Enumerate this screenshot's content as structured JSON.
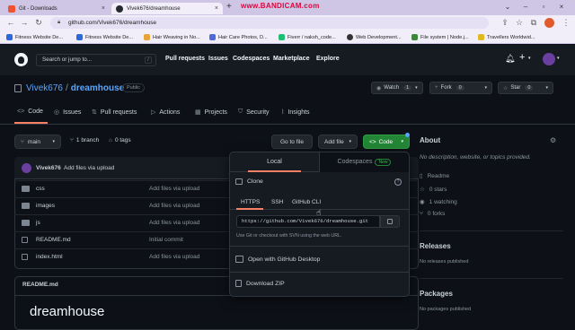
{
  "browser": {
    "tabs": [
      {
        "label": "Git - Downloads",
        "active": false
      },
      {
        "label": "Vivek676/dreamhouse",
        "active": true
      }
    ],
    "recorder_watermark": "www.BANDICAM.com",
    "url": "github.com/Vivek676/dreamhouse",
    "bookmarks": [
      "Fitness Website De...",
      "Fitness Website De...",
      "Hair Weaving in No...",
      "Hair Care Photos, D...",
      "Fiverr / naksh_code...",
      "Web Development...",
      "File system | Node.j...",
      "Travellers Worldwid..."
    ]
  },
  "github_header": {
    "search_placeholder": "Search or jump to...",
    "search_shortcut": "/",
    "nav": [
      "Pull requests",
      "Issues",
      "Codespaces",
      "Marketplace",
      "Explore"
    ],
    "plus_label": "+"
  },
  "repo": {
    "owner": "Vivek676",
    "separator": "/",
    "name": "dreamhouse",
    "visibility": "Public",
    "watch": {
      "label": "Watch",
      "count": "1"
    },
    "fork": {
      "label": "Fork",
      "count": "0"
    },
    "star": {
      "label": "Star",
      "count": "0"
    },
    "tabs": [
      "Code",
      "Issues",
      "Pull requests",
      "Actions",
      "Projects",
      "Security",
      "Insights"
    ]
  },
  "code_bar": {
    "branch": "main",
    "branches": "1 branch",
    "tags": "0 tags",
    "go_to_file": "Go to file",
    "add_file": "Add file",
    "code": "Code"
  },
  "commit": {
    "author": "Vivek676",
    "message": "Add files via upload"
  },
  "files": [
    {
      "name": "css",
      "type": "folder",
      "message": "Add files via upload"
    },
    {
      "name": "images",
      "type": "folder",
      "message": "Add files via upload"
    },
    {
      "name": "js",
      "type": "folder",
      "message": "Add files via upload"
    },
    {
      "name": "README.md",
      "type": "file",
      "message": "Initial commit"
    },
    {
      "name": "index.html",
      "type": "file",
      "message": "Add files via upload"
    }
  ],
  "readme": {
    "filename": "README.md",
    "heading": "dreamhouse"
  },
  "about": {
    "title": "About",
    "description": "No description, website, or topics provided.",
    "readme_label": "Readme",
    "stars": "0 stars",
    "watching": "1 watching",
    "forks": "0 forks"
  },
  "releases": {
    "title": "Releases",
    "text": "No releases published"
  },
  "packages": {
    "title": "Packages",
    "text": "No packages published"
  },
  "clone_dropdown": {
    "tab_local": "Local",
    "tab_codespaces": "Codespaces",
    "new_badge": "New",
    "clone_title": "Clone",
    "protocols": [
      "HTTPS",
      "SSH",
      "GitHub CLI"
    ],
    "clone_url": "https://github.com/Vivek676/dreamhouse.git",
    "hint": "Use Git or checkout with SVN using the web URL.",
    "open_desktop": "Open with GitHub Desktop",
    "download_zip": "Download ZIP"
  },
  "colors": {
    "accent_blue": "#58a6ff",
    "code_button_green": "#238636",
    "tab_underline": "#f78166",
    "watermark_red": "#e8003a"
  }
}
